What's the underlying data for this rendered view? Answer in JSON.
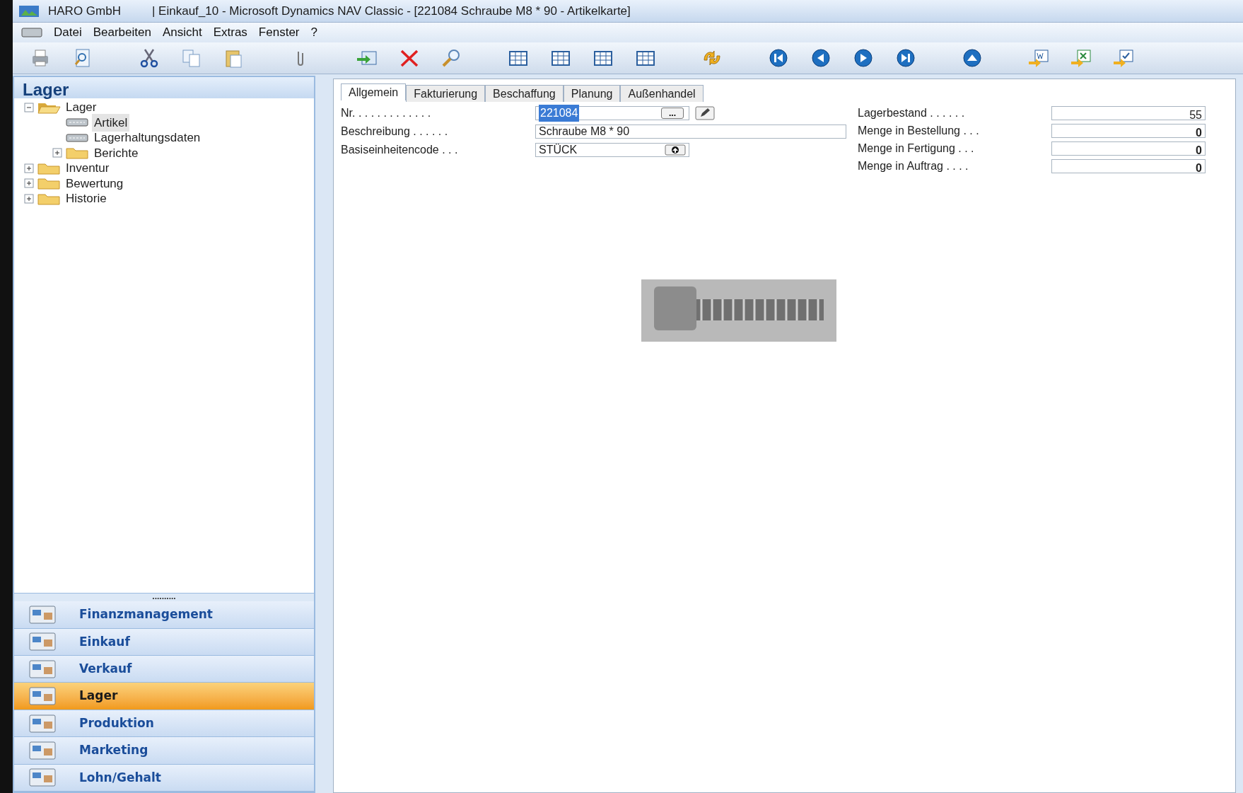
{
  "window": {
    "title_app": "HARO GmbH",
    "title": "| Einkauf_10 - Microsoft Dynamics NAV Classic - [221084 Schraube M8 * 90 - Artikelkarte]"
  },
  "menu": [
    "Datei",
    "Bearbeiten",
    "Ansicht",
    "Extras",
    "Fenster",
    "?"
  ],
  "toolbar": [
    {
      "kind": "printer"
    },
    {
      "kind": "preview"
    },
    {
      "kind": "gap"
    },
    {
      "kind": "cut"
    },
    {
      "kind": "copy"
    },
    {
      "kind": "paste"
    },
    {
      "kind": "gap"
    },
    {
      "kind": "clip"
    },
    {
      "kind": "gap"
    },
    {
      "kind": "card"
    },
    {
      "kind": "delete"
    },
    {
      "kind": "search"
    },
    {
      "kind": "gap"
    },
    {
      "kind": "grid"
    },
    {
      "kind": "grid"
    },
    {
      "kind": "grid"
    },
    {
      "kind": "grid"
    },
    {
      "kind": "gap"
    },
    {
      "kind": "refresh"
    },
    {
      "kind": "gap"
    },
    {
      "kind": "first"
    },
    {
      "kind": "prev"
    },
    {
      "kind": "next"
    },
    {
      "kind": "last"
    },
    {
      "kind": "gap"
    },
    {
      "kind": "up"
    },
    {
      "kind": "gap"
    },
    {
      "kind": "word"
    },
    {
      "kind": "excel"
    },
    {
      "kind": "check"
    }
  ],
  "sidebar": {
    "title": "Lager",
    "tree": [
      {
        "label": "Lager",
        "kind": "folder",
        "expanded": true,
        "children": [
          {
            "label": "Artikel",
            "kind": "form",
            "selected": true
          },
          {
            "label": "Lagerhaltungsdaten",
            "kind": "form",
            "selected": false
          },
          {
            "label": "Berichte",
            "kind": "folder",
            "expanded": false
          }
        ]
      },
      {
        "label": "Inventur",
        "kind": "folder",
        "expanded": false
      },
      {
        "label": "Bewertung",
        "kind": "folder",
        "expanded": false
      },
      {
        "label": "Historie",
        "kind": "folder",
        "expanded": false
      }
    ],
    "splitter": "..........",
    "nav": [
      {
        "label": "Finanzmanagement",
        "selected": false
      },
      {
        "label": "Einkauf",
        "selected": false
      },
      {
        "label": "Verkauf",
        "selected": false
      },
      {
        "label": "Lager",
        "selected": true
      },
      {
        "label": "Produktion",
        "selected": false
      },
      {
        "label": "Marketing",
        "selected": false
      },
      {
        "label": "Lohn/Gehalt",
        "selected": false
      }
    ]
  },
  "tabs": [
    {
      "label": "Allgemein",
      "selected": true
    },
    {
      "label": "Fakturierung",
      "selected": false
    },
    {
      "label": "Beschaffung",
      "selected": false
    },
    {
      "label": "Planung",
      "selected": false
    },
    {
      "label": "Außenhandel",
      "selected": false
    }
  ],
  "fields_left": [
    {
      "label": "Nr. . . . . . . . . . . . .",
      "value": "221084",
      "kind": "lookup",
      "lookup_text": "...",
      "selected": true
    },
    {
      "label": "Beschreibung . . . . . .",
      "value": "Schraube M8 * 90",
      "kind": "text",
      "selected": false
    },
    {
      "label": "Basiseinheitencode . . .",
      "value": "STÜCK",
      "kind": "upload",
      "selected": false
    }
  ],
  "fields_right": [
    {
      "label": "Lagerbestand . . . . . .",
      "value": "55",
      "bold": false
    },
    {
      "label": "Menge in Bestellung . . .",
      "value": "0",
      "bold": true
    },
    {
      "label": "Menge in Fertigung . . .",
      "value": "0",
      "bold": true
    },
    {
      "label": "Menge in Auftrag . . . .",
      "value": "0",
      "bold": true
    }
  ]
}
